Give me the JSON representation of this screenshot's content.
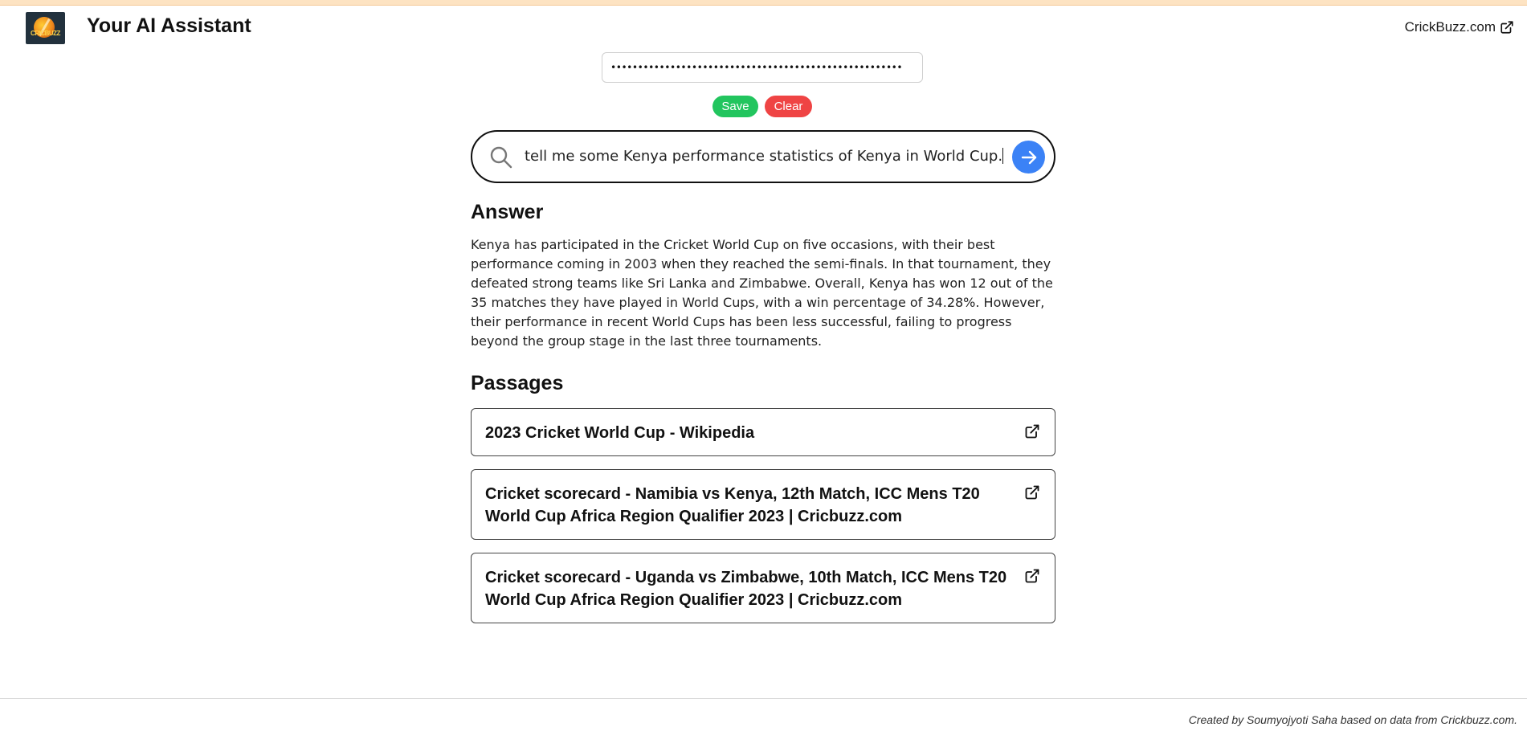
{
  "header": {
    "logo_text": "CRICBUZZ",
    "title": "Your AI Assistant",
    "external_link": "CrickBuzz.com"
  },
  "api_key": {
    "masked_value": "••••••••••••••••••••••••••••••••••••••••••••••••••••••"
  },
  "buttons": {
    "save": "Save",
    "clear": "Clear"
  },
  "search": {
    "query": "tell me some Kenya performance statistics of Kenya in World Cup."
  },
  "answer": {
    "heading": "Answer",
    "text": "Kenya has participated in the Cricket World Cup on five occasions, with their best performance coming in 2003 when they reached the semi-finals. In that tournament, they defeated strong teams like Sri Lanka and Zimbabwe. Overall, Kenya has won 12 out of the 35 matches they have played in World Cups, with a win percentage of 34.28%. However, their performance in recent World Cups has been less successful, failing to progress beyond the group stage in the last three tournaments."
  },
  "passages": {
    "heading": "Passages",
    "items": [
      {
        "title": "2023 Cricket World Cup - Wikipedia"
      },
      {
        "title": "Cricket scorecard - Namibia vs Kenya, 12th Match, ICC Mens T20 World Cup Africa Region Qualifier 2023 | Cricbuzz.com"
      },
      {
        "title": "Cricket scorecard - Uganda vs Zimbabwe, 10th Match, ICC Mens T20 World Cup Africa Region Qualifier 2023 | Cricbuzz.com"
      }
    ]
  },
  "footer": {
    "credit": "Created by Soumyojyoti Saha based on data from Crickbuzz.com."
  },
  "colors": {
    "save": "#22c55e",
    "clear": "#ef4444",
    "go": "#3b82f6",
    "top_strip": "#fde3c2"
  }
}
